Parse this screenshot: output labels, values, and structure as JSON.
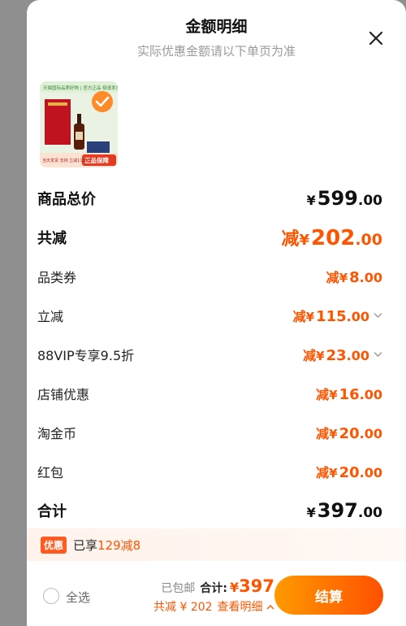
{
  "header": {
    "title": "金额明细",
    "subtitle": "实际优惠金额请以下单页为准"
  },
  "product": {
    "banner_text": "天猫国际品质好物 | 官方正品 极速发货",
    "badge_text": "正品保障",
    "bottom_text": "当天发货 支持 立减115元"
  },
  "rows": {
    "total_price": {
      "label": "商品总价",
      "yen": "¥",
      "int": "599",
      "dec": ".00"
    },
    "total_reduce": {
      "label": "共减",
      "prefix": "减",
      "yen": "¥",
      "int": "202",
      "dec": ".00"
    },
    "category_coupon": {
      "label": "品类券",
      "prefix": "减",
      "yen": "¥",
      "int": "8",
      "dec": ".00"
    },
    "instant_reduce": {
      "label": "立减",
      "prefix": "减",
      "yen": "¥",
      "int": "115",
      "dec": ".00"
    },
    "vip_discount": {
      "label": "88VIP专享9.5折",
      "prefix": "减",
      "yen": "¥",
      "int": "23",
      "dec": ".00"
    },
    "store_discount": {
      "label": "店铺优惠",
      "prefix": "减",
      "yen": "¥",
      "int": "16",
      "dec": ".00"
    },
    "taojinbi": {
      "label": "淘金币",
      "prefix": "减",
      "yen": "¥",
      "int": "20",
      "dec": ".00"
    },
    "red_packet": {
      "label": "红包",
      "prefix": "减",
      "yen": "¥",
      "int": "20",
      "dec": ".00"
    },
    "grand_total": {
      "label": "合计",
      "yen": "¥",
      "int": "397",
      "dec": ".00"
    }
  },
  "promo": {
    "badge": "优惠",
    "text_prefix": "已享",
    "text_accent": "129减8"
  },
  "footer": {
    "select_all": "全选",
    "free_shipping": "已包邮",
    "total_label": "合计:",
    "total_yen": "¥",
    "total_amount": "397",
    "reduced_text": "共减 ¥ 202",
    "view_details": "查看明细",
    "checkout": "结算"
  },
  "colors": {
    "accent": "#ff5500",
    "checkout_gradient_start": "#ff9a00",
    "checkout_gradient_end": "#ff5000"
  }
}
